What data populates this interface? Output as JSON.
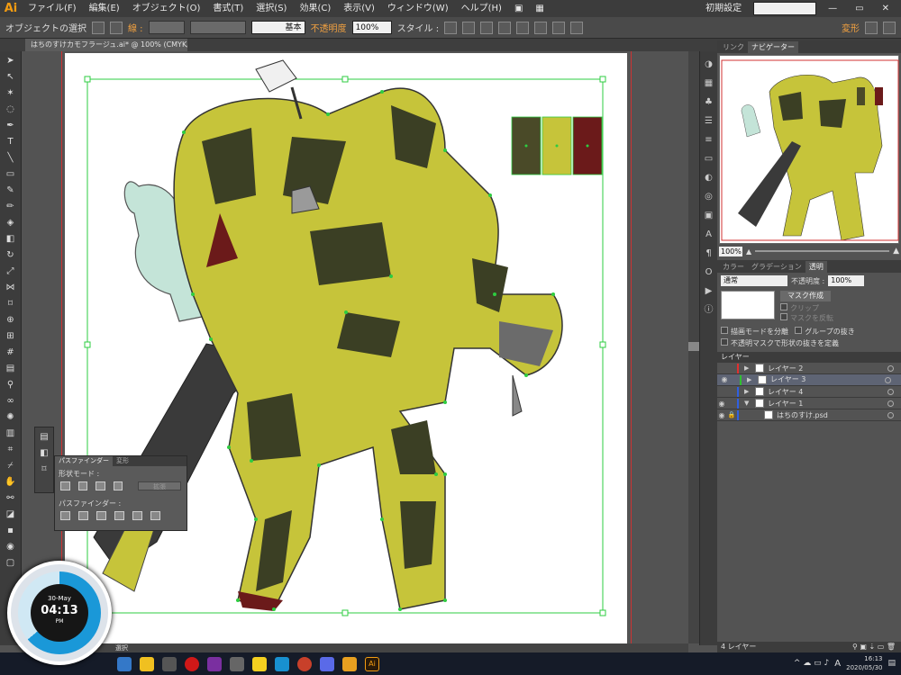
{
  "app": {
    "logo": "Ai"
  },
  "menu": [
    "ファイル(F)",
    "編集(E)",
    "オブジェクト(O)",
    "書式(T)",
    "選択(S)",
    "効果(C)",
    "表示(V)",
    "ウィンドウ(W)",
    "ヘルプ(H)"
  ],
  "workspace": {
    "label": "初期設定",
    "search_placeholder": ""
  },
  "control": {
    "selection_label": "オブジェクトの選択",
    "stroke_label": "線 :",
    "stroke_style": "基本",
    "opacity_label": "不透明度",
    "opacity_value": "100%",
    "style_label": "スタイル :",
    "transform_label": "変形"
  },
  "document": {
    "tab_title": "はちのすけカモフラージュ.ai* @ 100% (CMYK/プレビュー)"
  },
  "navigator": {
    "tab_link": "リンク",
    "tab_nav": "ナビゲーター",
    "zoom": "100%"
  },
  "transparency": {
    "tabs": [
      "カラー",
      "グラデーション",
      "透明"
    ],
    "blend_mode": "通常",
    "opacity_label": "不透明度 :",
    "opacity_value": "100%",
    "mask_button": "マスク作成",
    "clip_label": "クリップ",
    "invert_label": "マスクを反転",
    "isolate_label": "描画モードを分離",
    "knockout_label": "グループの抜き",
    "opacity_mask_label": "不透明マスクで形状の抜きを定義"
  },
  "layers": {
    "panel_title": "レイヤー",
    "rows": [
      {
        "name": "レイヤー 2",
        "color": "#e03030",
        "visible": false,
        "selected": false,
        "expanded": false,
        "locked": false
      },
      {
        "name": "レイヤー 3",
        "color": "#30c030",
        "visible": true,
        "selected": true,
        "expanded": false,
        "locked": false
      },
      {
        "name": "レイヤー 4",
        "color": "#3060e0",
        "visible": false,
        "selected": false,
        "expanded": false,
        "locked": false
      },
      {
        "name": "レイヤー 1",
        "color": "#3060e0",
        "visible": true,
        "selected": false,
        "expanded": true,
        "locked": false
      },
      {
        "name": "はちのすけ.psd",
        "color": "#3060e0",
        "visible": true,
        "selected": false,
        "expanded": false,
        "locked": true,
        "child": true
      }
    ],
    "footer": "4 レイヤー"
  },
  "pathfinder": {
    "tabs": [
      "パスファインダー",
      "変形"
    ],
    "shape_modes_label": "形状モード :",
    "expand_label": "拡張",
    "pathfinders_label": "パスファインダー :"
  },
  "status": {
    "zoom": "",
    "tool": "選択"
  },
  "swatches": [
    "#4a4a28",
    "#c6c43a",
    "#6b1a1a"
  ],
  "taskbar": {
    "time": "16:13",
    "date": "2020/05/30",
    "ime": "A"
  },
  "clock_widget": {
    "date": "30-May",
    "time": "04:13",
    "ampm": "PM"
  },
  "colors": {
    "accent_green": "#2ecc40",
    "robot_yellow": "#c6c43a",
    "robot_dark": "#3b3f24",
    "robot_red": "#6b1a1a"
  }
}
